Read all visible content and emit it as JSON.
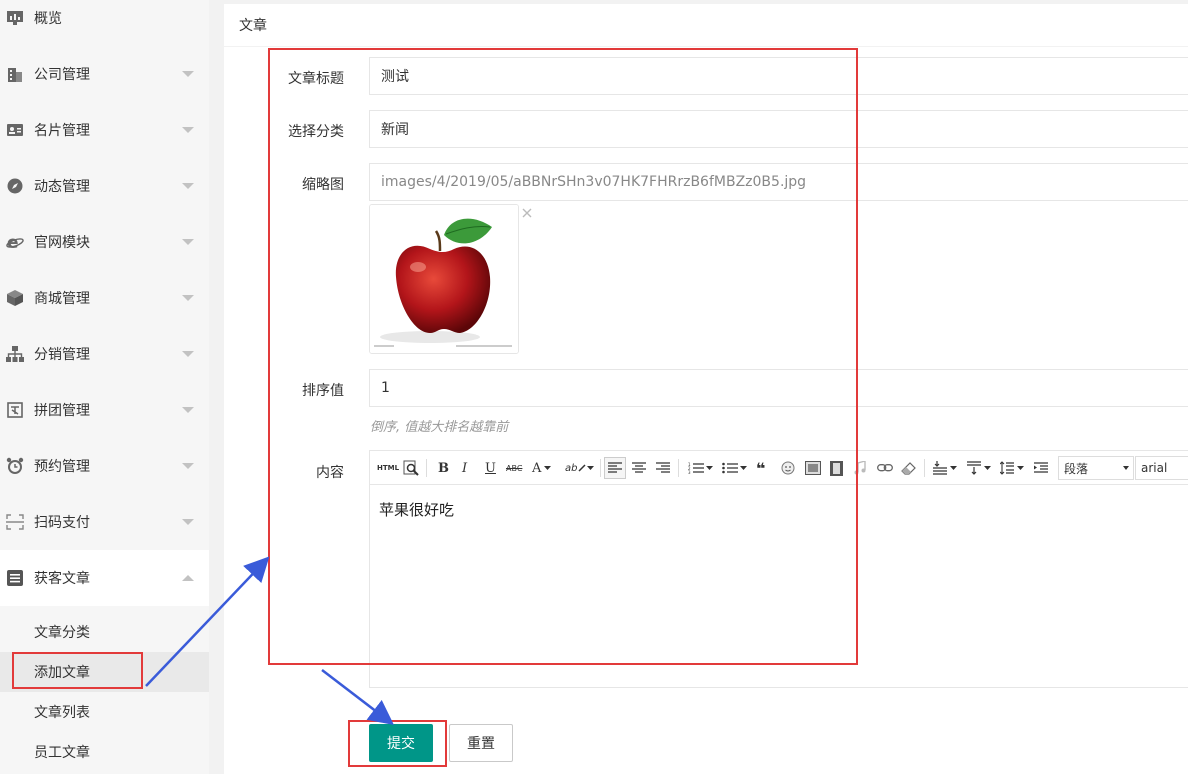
{
  "sidebar": {
    "items": [
      {
        "label": "概览",
        "icon": "chart-icon"
      },
      {
        "label": "公司管理",
        "icon": "building-icon"
      },
      {
        "label": "名片管理",
        "icon": "card-icon"
      },
      {
        "label": "动态管理",
        "icon": "compass-icon"
      },
      {
        "label": "官网模块",
        "icon": "ie-icon"
      },
      {
        "label": "商城管理",
        "icon": "cube-icon"
      },
      {
        "label": "分销管理",
        "icon": "sitemap-icon"
      },
      {
        "label": "拼团管理",
        "icon": "group-icon"
      },
      {
        "label": "预约管理",
        "icon": "alarm-icon"
      },
      {
        "label": "扫码支付",
        "icon": "scan-icon"
      },
      {
        "label": "获客文章",
        "icon": "article-icon"
      }
    ],
    "sub_items": [
      {
        "label": "文章分类"
      },
      {
        "label": "添加文章"
      },
      {
        "label": "文章列表"
      },
      {
        "label": "员工文章"
      }
    ]
  },
  "main": {
    "title": "文章",
    "form": {
      "title_label": "文章标题",
      "title_value": "测试",
      "category_label": "选择分类",
      "category_value": "新闻",
      "thumbnail_label": "缩略图",
      "thumbnail_path": "images/4/2019/05/aBBNrSHn3v07HK7FHRrzB6fMBZz0B5.jpg",
      "sort_label": "排序值",
      "sort_value": "1",
      "sort_hint": "倒序, 值越大排名越靠前",
      "content_label": "内容",
      "content_text": "苹果很好吃"
    },
    "toolbar": {
      "html_label": "HTML",
      "bold": "B",
      "italic": "I",
      "underline": "U",
      "strike": "ABC",
      "font_color": "A",
      "highlight": "ab",
      "paragraph_select": "段落",
      "font_select": "arial"
    },
    "buttons": {
      "submit": "提交",
      "reset": "重置"
    }
  },
  "colors": {
    "primary": "#009688",
    "annotation": "#e23a3a",
    "arrow": "#3a5bd9"
  }
}
